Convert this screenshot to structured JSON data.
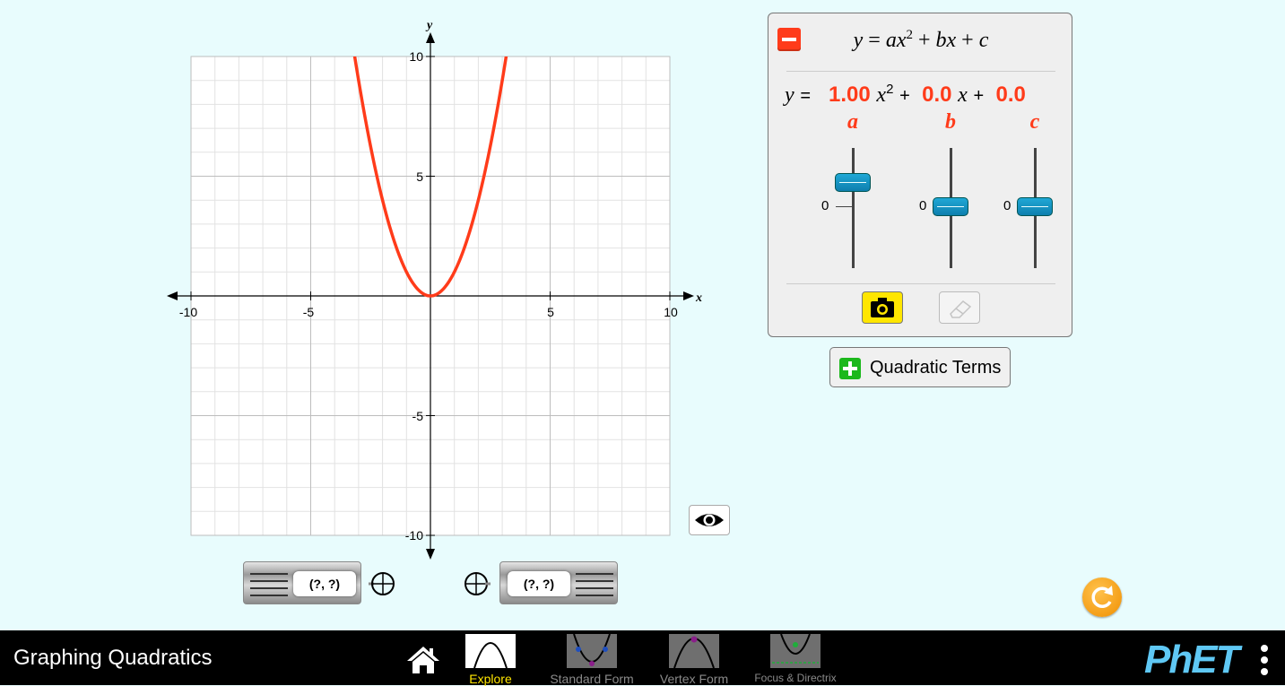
{
  "sim_title": "Graphing Quadratics",
  "graph": {
    "x_axis_label": "x",
    "y_axis_label": "y",
    "x_range": [
      -10,
      10
    ],
    "y_range": [
      -10,
      10
    ],
    "x_tick_labels": [
      "-10",
      "-5",
      "5",
      "10"
    ],
    "y_tick_labels": [
      "10",
      "5",
      "-5",
      "-10"
    ],
    "curve_color": "#ff3b1a",
    "equation": {
      "a": 1.0,
      "b": 0.0,
      "c": 0.0
    }
  },
  "equation_panel": {
    "title_y": "y",
    "title_eq": "=",
    "title_ax": "ax",
    "title_sup": "2",
    "title_plus1": "+",
    "title_bx": "bx",
    "title_plus2": "+",
    "title_c": "c",
    "line_y": "y",
    "line_eq": "=",
    "a_value": "1.00",
    "x2": "x",
    "sup2": "2",
    "plus1": "+",
    "b_value": "0.0",
    "x1": "x",
    "plus2": "+",
    "c_value": "0.0",
    "label_a": "a",
    "label_b": "b",
    "label_c": "c",
    "slider_zero": "0",
    "sliders": {
      "a": 1.0,
      "b": 0.0,
      "c": 0.0
    }
  },
  "quadratic_terms_label": "Quadratic Terms",
  "point_tools": {
    "left_readout": "(?, ?)",
    "right_readout": "(?, ?)"
  },
  "nav": {
    "screens": [
      {
        "label": "Explore"
      },
      {
        "label": "Standard Form"
      },
      {
        "label": "Vertex Form"
      },
      {
        "label": "Focus & Directrix"
      }
    ],
    "logo_text": "PhET"
  },
  "icons": [
    "collapse-icon",
    "camera-icon",
    "eraser-icon",
    "plus-icon",
    "eye-icon",
    "crosshair-icon",
    "reset-icon",
    "home-icon",
    "menu-icon"
  ]
}
